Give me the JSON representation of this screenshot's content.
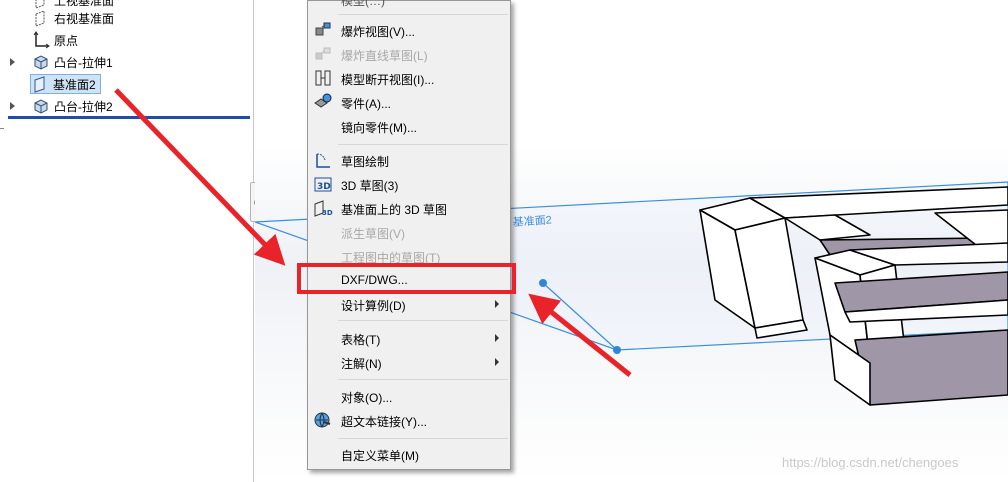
{
  "tree": {
    "items": [
      {
        "label": "上视基准面",
        "icon": "plane-icon"
      },
      {
        "label": "右视基准面",
        "icon": "plane-icon"
      },
      {
        "label": "原点",
        "icon": "origin-icon"
      },
      {
        "label": "凸台-拉伸1",
        "icon": "extrude-icon"
      },
      {
        "label": "基准面2",
        "icon": "plane-icon",
        "selected": true
      },
      {
        "label": "凸台-拉伸2",
        "icon": "extrude-icon"
      }
    ]
  },
  "menu": {
    "top_partial_label": "模型(…)",
    "items": [
      {
        "label": "爆炸视图(V)...",
        "icon": "explode-view-icon",
        "enabled": true
      },
      {
        "label": "爆炸直线草图(L)",
        "icon": "explode-line-sketch-icon",
        "enabled": false
      },
      {
        "label": "模型断开视图(I)...",
        "icon": "broken-view-icon",
        "enabled": true
      },
      {
        "label": "零件(A)...",
        "icon": "part-icon",
        "enabled": true
      },
      {
        "label": "镜向零件(M)...",
        "icon": "",
        "enabled": true
      },
      {
        "label": "草图绘制",
        "icon": "sketch-icon",
        "enabled": true
      },
      {
        "label": "3D 草图(3)",
        "icon": "3d-sketch-icon",
        "enabled": true
      },
      {
        "label": "基准面上的 3D 草图",
        "icon": "3d-sketch-on-plane-icon",
        "enabled": true
      },
      {
        "label": "派生草图(V)",
        "icon": "",
        "enabled": false
      },
      {
        "label": "工程图中的草图(T)",
        "icon": "",
        "enabled": false
      },
      {
        "label": "DXF/DWG...",
        "icon": "",
        "enabled": true
      },
      {
        "label": "设计算例(D)",
        "icon": "",
        "enabled": true,
        "submenu": true
      },
      {
        "label": "表格(T)",
        "icon": "",
        "enabled": true,
        "submenu": true
      },
      {
        "label": "注解(N)",
        "icon": "",
        "enabled": true,
        "submenu": true
      },
      {
        "label": "对象(O)...",
        "icon": "",
        "enabled": true
      },
      {
        "label": "超文本链接(Y)...",
        "icon": "hyperlink-icon",
        "enabled": true
      },
      {
        "label": "自定义菜单(M)",
        "icon": "",
        "enabled": true
      }
    ]
  },
  "viewport": {
    "plane_label": "基准面2"
  },
  "watermark": "https://blog.csdn.net/chengoes",
  "colors": {
    "annotation_red": "#e8232a",
    "selection_blue": "#cfe3f7",
    "plane_blue": "#3b8fe0",
    "face_gray": "#9f97a8"
  }
}
